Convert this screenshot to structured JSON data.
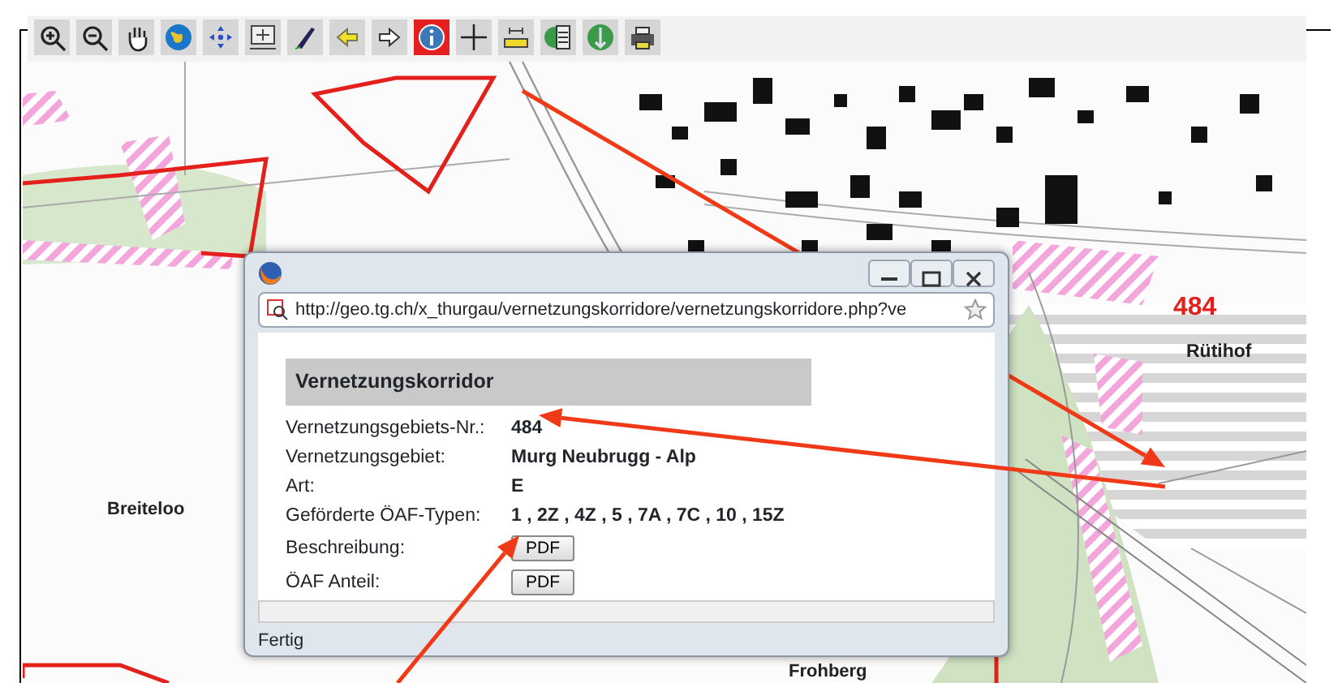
{
  "toolbar": [
    {
      "kind": "zoomin",
      "selected": false
    },
    {
      "kind": "zoomout",
      "selected": false
    },
    {
      "kind": "pan",
      "selected": false
    },
    {
      "kind": "globe",
      "selected": false
    },
    {
      "kind": "extent",
      "selected": false
    },
    {
      "kind": "fit",
      "selected": false
    },
    {
      "kind": "pen",
      "selected": false
    },
    {
      "kind": "back",
      "selected": false
    },
    {
      "kind": "forward",
      "selected": false
    },
    {
      "kind": "info",
      "selected": true
    },
    {
      "kind": "cross",
      "selected": false
    },
    {
      "kind": "measure",
      "selected": false
    },
    {
      "kind": "layers",
      "selected": false
    },
    {
      "kind": "globe2",
      "selected": false
    },
    {
      "kind": "print",
      "selected": false
    }
  ],
  "map": {
    "labels": [
      {
        "text": "484",
        "kind": "number"
      },
      {
        "text": "Rütihof",
        "kind": "place"
      },
      {
        "text": "Breiteloo",
        "kind": "place"
      },
      {
        "text": "Frohberg",
        "kind": "place"
      }
    ]
  },
  "popup": {
    "url": "http://geo.tg.ch/x_thurgau/vernetzungskorridore/vernetzungskorridore.php?ve",
    "heading": "Vernetzungskorridor",
    "rows": [
      {
        "label": "Vernetzungsgebiets-Nr.:",
        "kind": "text",
        "value": "484"
      },
      {
        "label": "Vernetzungsgebiet:",
        "kind": "text",
        "value": "Murg Neubrugg - Alp"
      },
      {
        "label": "Art:",
        "kind": "text",
        "value": "E"
      },
      {
        "label": "Geförderte ÖAF-Typen:",
        "kind": "text",
        "value": "1 , 2Z , 4Z , 5 , 7A , 7C , 10 , 15Z"
      },
      {
        "label": "Beschreibung:",
        "kind": "button",
        "value": "PDF"
      },
      {
        "label": "ÖAF Anteil:",
        "kind": "button",
        "value": "PDF"
      }
    ],
    "status": "Fertig"
  }
}
